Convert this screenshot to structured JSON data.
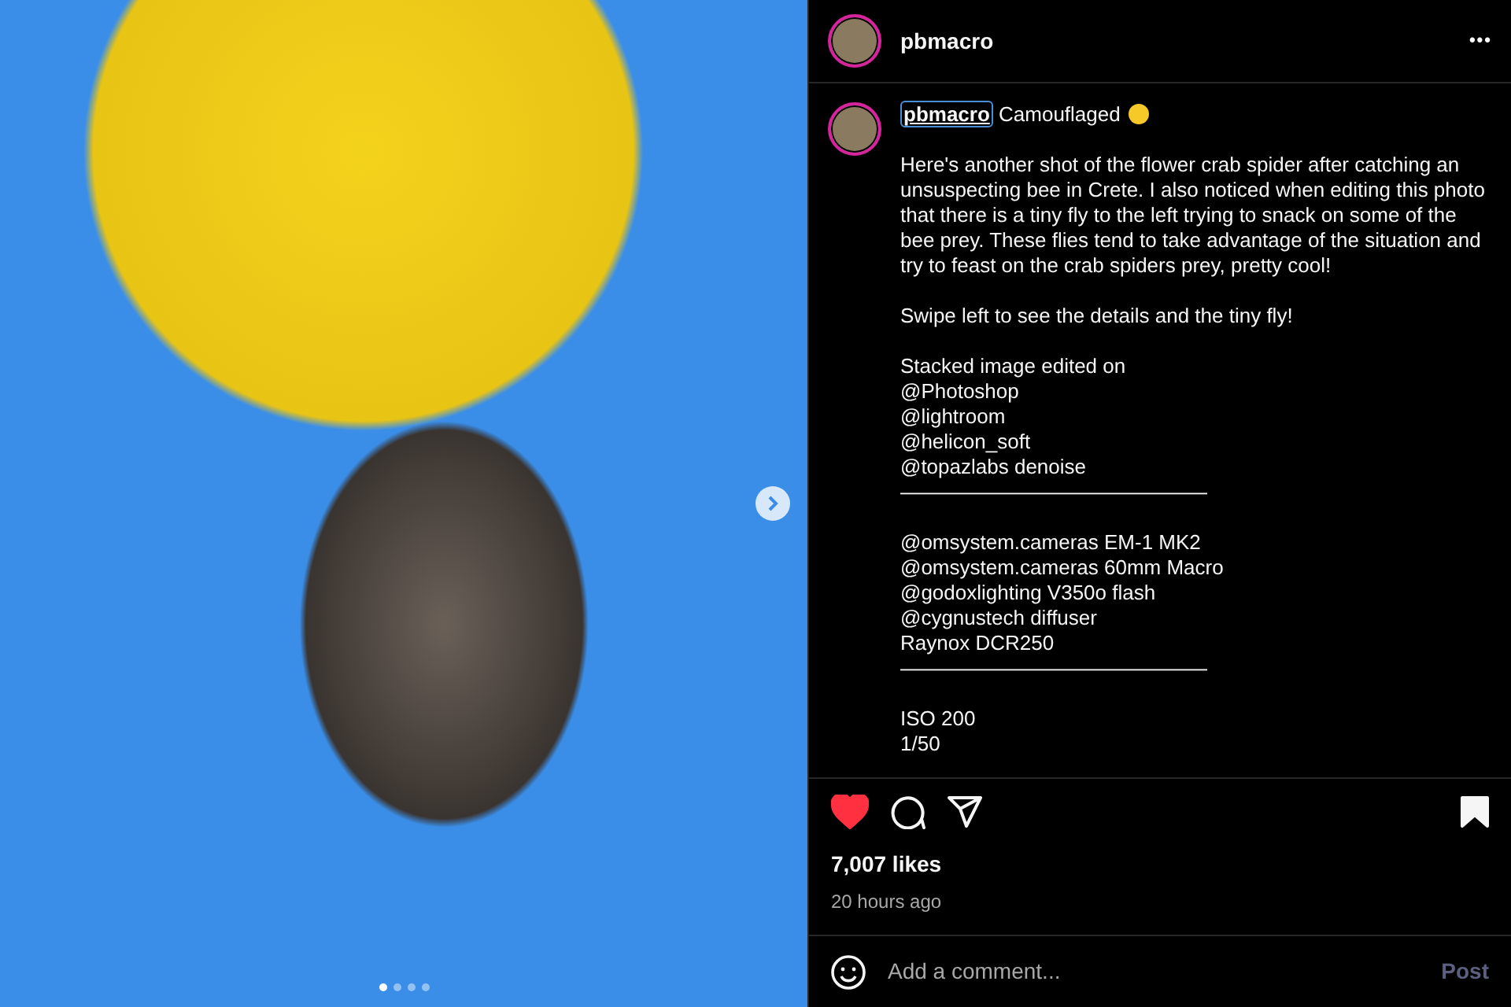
{
  "post": {
    "carousel_dots": [
      {
        "selected": true
      },
      {
        "selected": false
      },
      {
        "selected": false
      },
      {
        "selected": false
      }
    ]
  },
  "header": {
    "username": "pbmacro",
    "more": "•••"
  },
  "caption": {
    "username": "pbmacro",
    "title": "Camouflaged",
    "paragraphs": [
      {
        "lines": [
          "Here's another shot of the flower crab spider after catching an unsuspecting bee in Crete. I also noticed when editing this photo that there is a tiny fly to the left trying to snack on some of the bee prey. These flies tend to take advantage of the situation and try to feast on the crab spiders prey, pretty cool!"
        ]
      },
      {
        "lines": [
          "Swipe left to see the details and the tiny fly!"
        ]
      },
      {
        "lines": [
          "Stacked image edited on",
          "@Photoshop",
          "@lightroom",
          "@helicon_soft",
          "@topazlabs denoise",
          "———————————————"
        ]
      },
      {
        "lines": [
          "@omsystem.cameras EM-1 MK2",
          "@omsystem.cameras 60mm Macro",
          "@godoxlighting V350o flash",
          "@cygnustech diffuser",
          "Raynox DCR250",
          "———————————————"
        ]
      },
      {
        "lines": [
          "ISO 200",
          "1/50"
        ]
      }
    ]
  },
  "actions": {
    "liked": true,
    "saved": true
  },
  "likes": "7,007 likes",
  "time": "20 hours ago",
  "comment": {
    "placeholder": "Add a comment...",
    "post_button": "Post",
    "post_disabled": true
  }
}
